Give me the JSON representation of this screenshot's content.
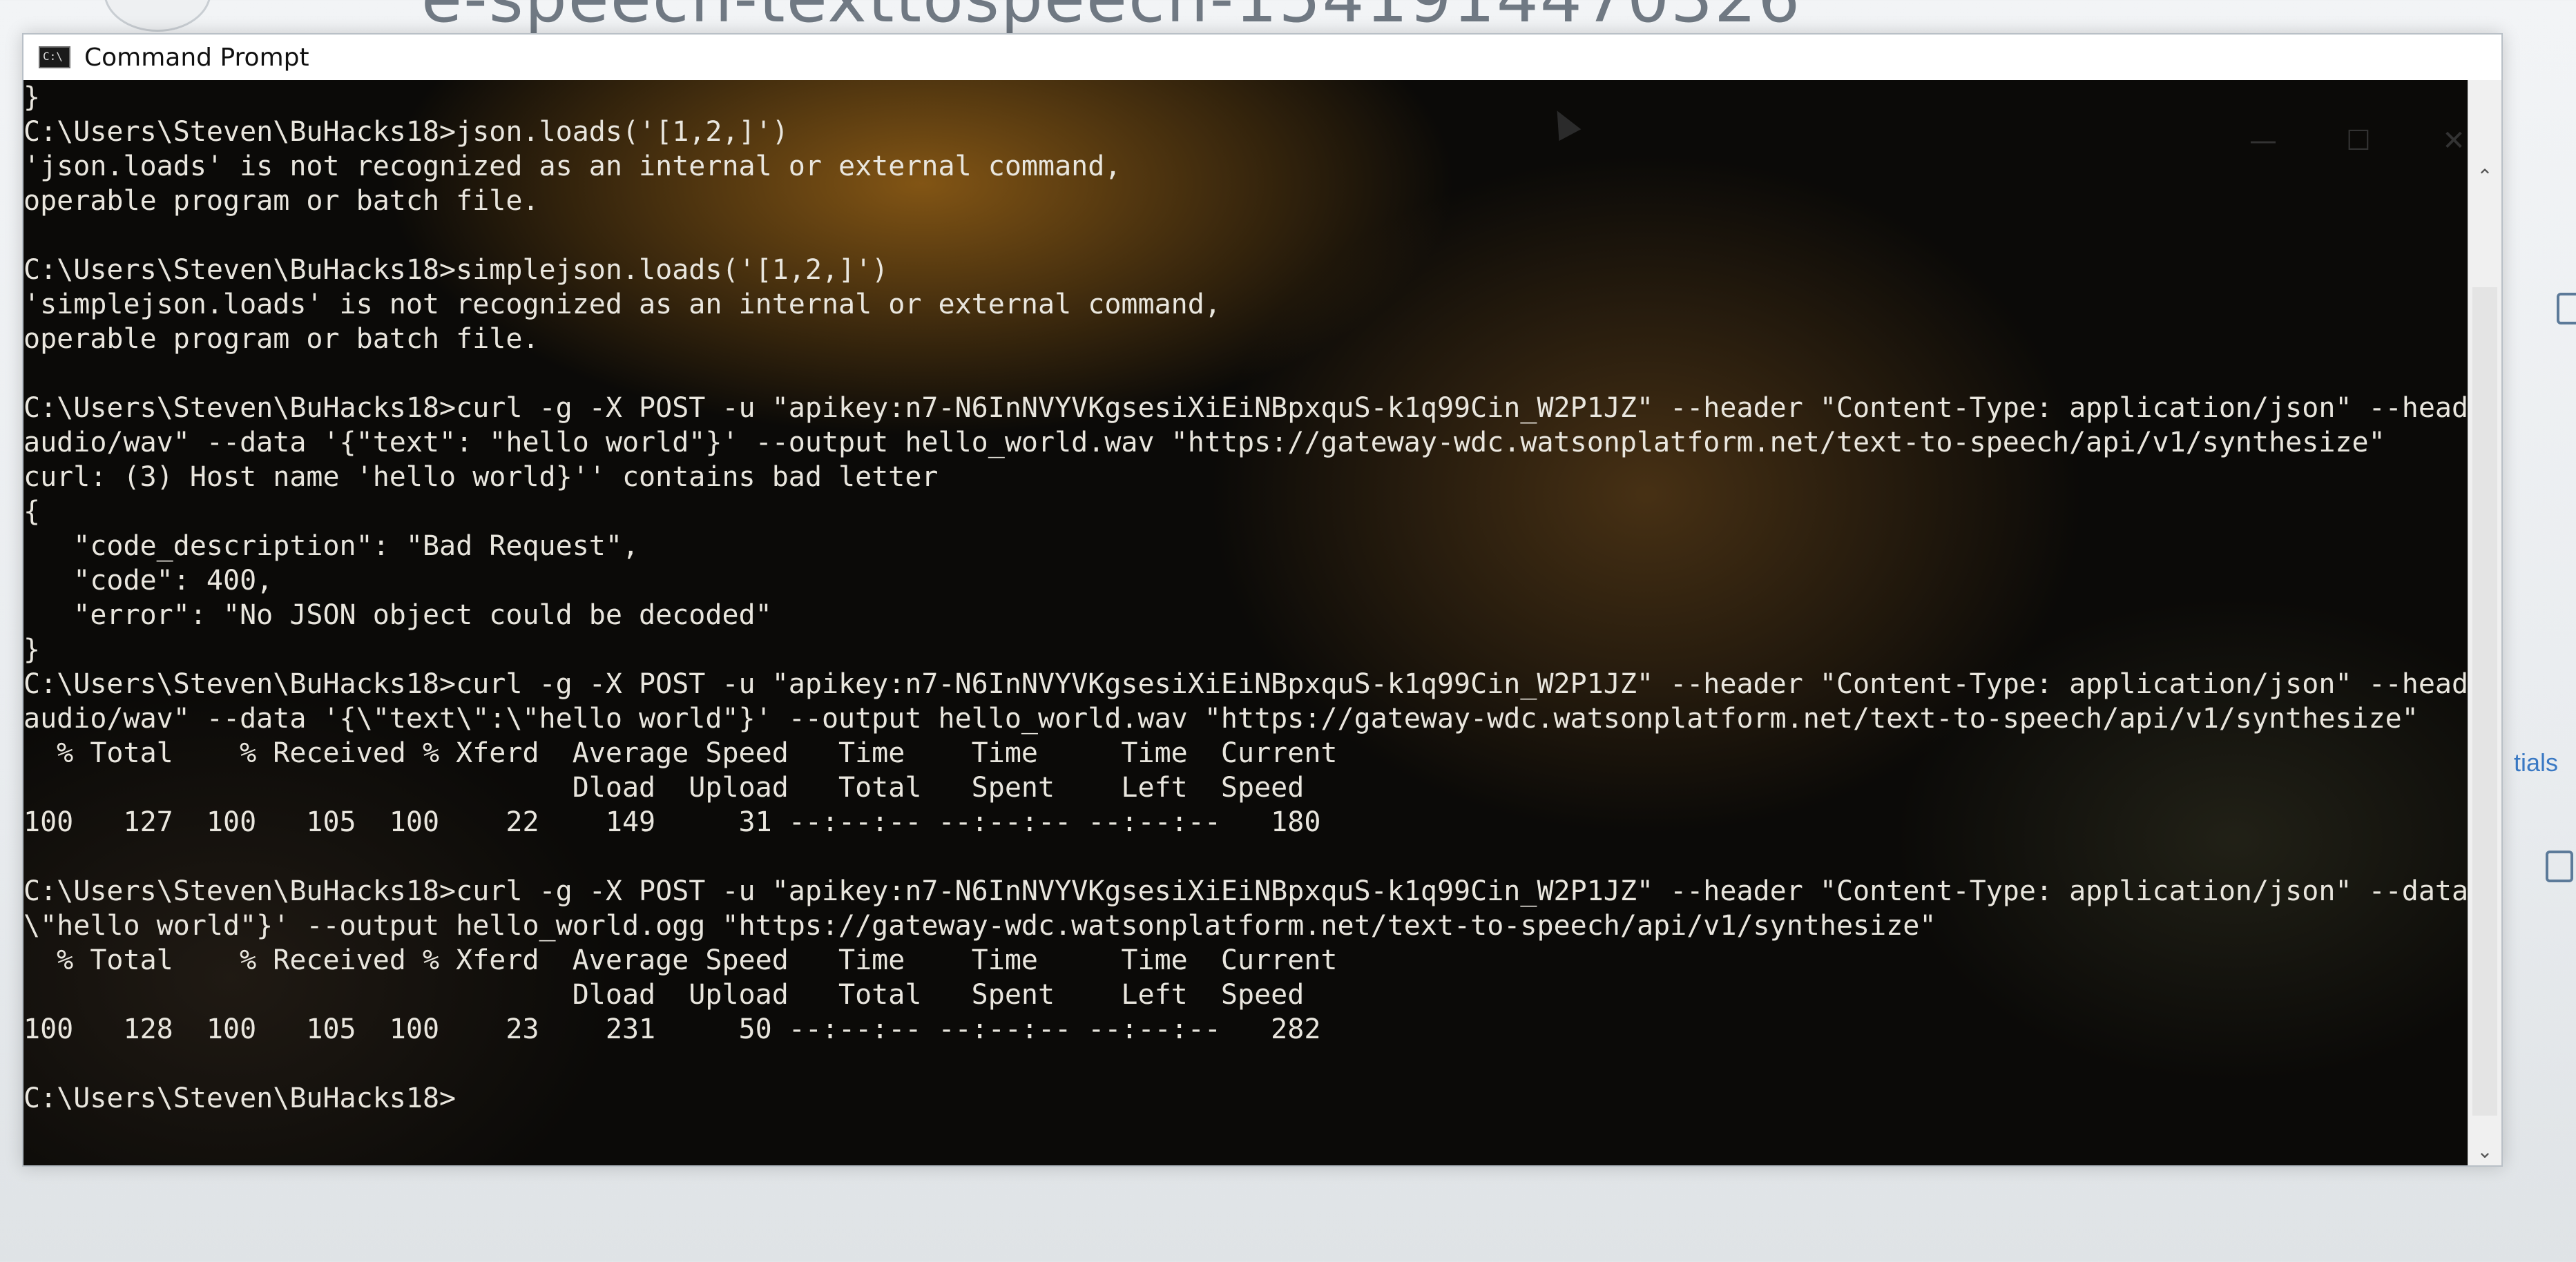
{
  "background": {
    "page_title_fragment": "e-speech-texttospeech-1541914470326",
    "side_link_fragment": "tials"
  },
  "window": {
    "title": "Command Prompt",
    "app_icon_text": "C:\\",
    "controls": {
      "minimize": "—",
      "maximize": "☐",
      "close": "✕"
    }
  },
  "terminal": {
    "lines": [
      "}",
      "C:\\Users\\Steven\\BuHacks18>json.loads('[1,2,]')",
      "'json.loads' is not recognized as an internal or external command,",
      "operable program or batch file.",
      "",
      "C:\\Users\\Steven\\BuHacks18>simplejson.loads('[1,2,]')",
      "'simplejson.loads' is not recognized as an internal or external command,",
      "operable program or batch file.",
      "",
      "C:\\Users\\Steven\\BuHacks18>curl -g -X POST -u \"apikey:n7-N6InNVYVKgsesiXiEiNBpxquS-k1q99Cin_W2P1JZ\" --header \"Content-Type: application/json\" --header \"Accept:",
      "audio/wav\" --data '{\"text\": \"hello world\"}' --output hello_world.wav \"https://gateway-wdc.watsonplatform.net/text-to-speech/api/v1/synthesize\"",
      "curl: (3) Host name 'hello world}'' contains bad letter",
      "{",
      "   \"code_description\": \"Bad Request\",",
      "   \"code\": 400,",
      "   \"error\": \"No JSON object could be decoded\"",
      "}",
      "C:\\Users\\Steven\\BuHacks18>curl -g -X POST -u \"apikey:n7-N6InNVYVKgsesiXiEiNBpxquS-k1q99Cin_W2P1JZ\" --header \"Content-Type: application/json\" --header \"Accept:",
      "audio/wav\" --data '{\\\"text\\\":\\\"hello world\"}' --output hello_world.wav \"https://gateway-wdc.watsonplatform.net/text-to-speech/api/v1/synthesize\"",
      "  % Total    % Received % Xferd  Average Speed   Time    Time     Time  Current",
      "                                 Dload  Upload   Total   Spent    Left  Speed",
      "100   127  100   105  100    22    149     31 --:--:-- --:--:-- --:--:--   180",
      "",
      "C:\\Users\\Steven\\BuHacks18>curl -g -X POST -u \"apikey:n7-N6InNVYVKgsesiXiEiNBpxquS-k1q99Cin_W2P1JZ\" --header \"Content-Type: application/json\" --data '{\\\"text\\\":",
      "\\\"hello world\"}' --output hello_world.ogg \"https://gateway-wdc.watsonplatform.net/text-to-speech/api/v1/synthesize\"",
      "  % Total    % Received % Xferd  Average Speed   Time    Time     Time  Current",
      "                                 Dload  Upload   Total   Spent    Left  Speed",
      "100   128  100   105  100    23    231     50 --:--:-- --:--:-- --:--:--   282",
      "",
      "C:\\Users\\Steven\\BuHacks18>"
    ]
  }
}
